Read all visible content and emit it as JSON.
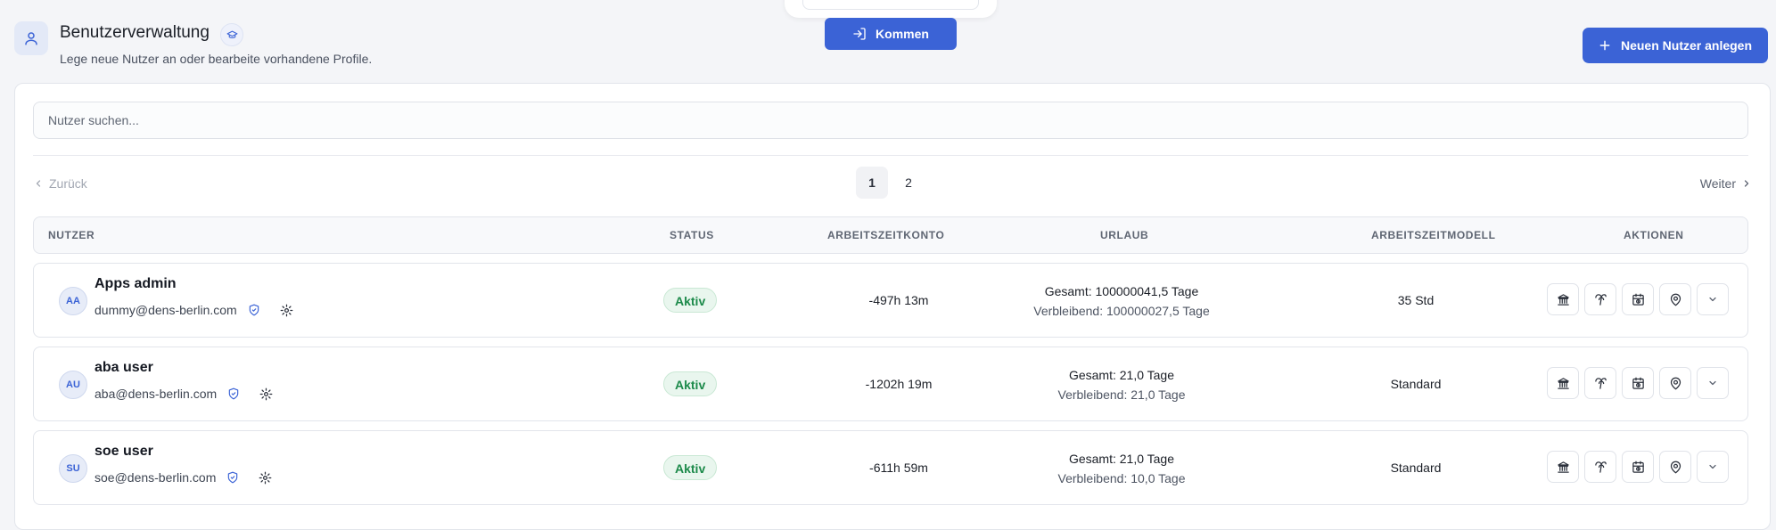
{
  "header": {
    "title": "Benutzerverwaltung",
    "subtitle": "Lege neue Nutzer an oder bearbeite vorhandene Profile.",
    "kommen_label": "Kommen",
    "new_user_label": "Neuen Nutzer anlegen"
  },
  "search": {
    "placeholder": "Nutzer suchen..."
  },
  "pagination": {
    "prev": "Zurück",
    "next": "Weiter",
    "pages": [
      "1",
      "2"
    ],
    "current": "1"
  },
  "table": {
    "headers": {
      "user": "NUTZER",
      "status": "STATUS",
      "konto": "ARBEITSZEITKONTO",
      "urlaub": "URLAUB",
      "modell": "ARBEITSZEITMODELL",
      "aktionen": "AKTIONEN"
    },
    "rows": [
      {
        "initials": "AA",
        "name": "Apps admin",
        "email": "dummy@dens-berlin.com",
        "status": "Aktiv",
        "konto": "-497h 13m",
        "urlaub_total": "Gesamt: 100000041,5 Tage",
        "urlaub_rest": "Verbleibend: 100000027,5 Tage",
        "modell": "35 Std"
      },
      {
        "initials": "AU",
        "name": "aba user",
        "email": "aba@dens-berlin.com",
        "status": "Aktiv",
        "konto": "-1202h 19m",
        "urlaub_total": "Gesamt: 21,0 Tage",
        "urlaub_rest": "Verbleibend: 21,0 Tage",
        "modell": "Standard"
      },
      {
        "initials": "SU",
        "name": "soe user",
        "email": "soe@dens-berlin.com",
        "status": "Aktiv",
        "konto": "-611h 59m",
        "urlaub_total": "Gesamt: 21,0 Tage",
        "urlaub_rest": "Verbleibend: 10,0 Tage",
        "modell": "Standard"
      }
    ],
    "actions": [
      "bank-icon",
      "palm-tree-icon",
      "calendar-clock-icon",
      "map-pin-icon",
      "chevron-down-icon"
    ]
  },
  "colors": {
    "accent": "#3b63d6",
    "status_active": "#1c8a4a"
  }
}
